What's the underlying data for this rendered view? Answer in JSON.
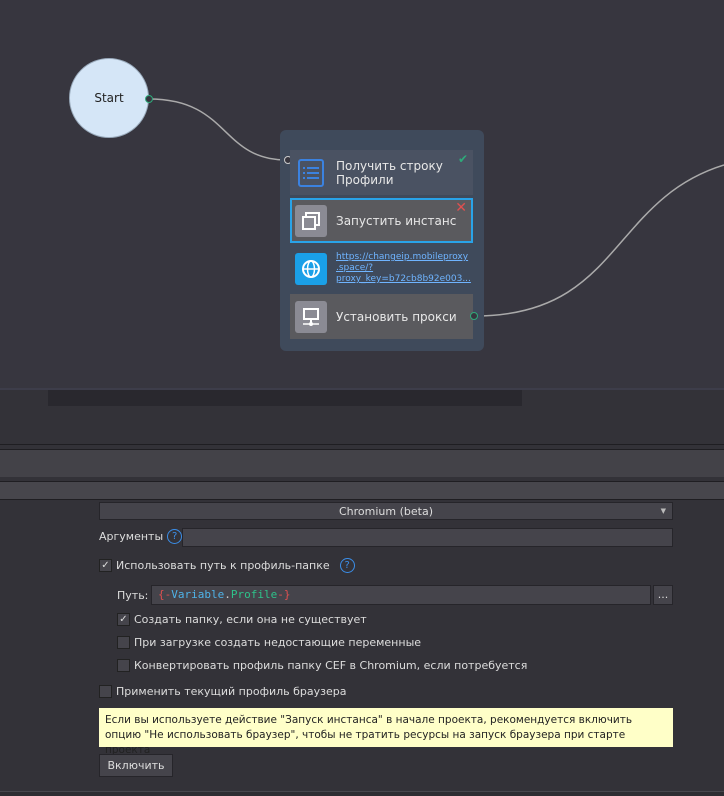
{
  "canvas": {
    "start_label": "Start",
    "nodes": [
      {
        "label": "Получить строку Профили",
        "status": "check",
        "icon": "list-icon"
      },
      {
        "label": "Запустить инстанс",
        "status": "error",
        "icon": "windows-icon"
      },
      {
        "link": "https://changeip.mobileproxy.space/?proxy_key=b72cb8b92e003...",
        "link_lines": [
          "https://changeip.mobileproxy",
          ".space/?",
          "proxy_key=b72cb8b92e003..."
        ],
        "icon": "globe-icon"
      },
      {
        "label": "Установить прокси",
        "icon": "network-icon"
      }
    ]
  },
  "settings": {
    "browser_select": "Chromium (beta)",
    "arguments_label": "Аргументы",
    "arguments_value": "",
    "use_profile_label": "Использовать путь к профиль-папке",
    "use_profile_checked": true,
    "path_label": "Путь:",
    "path_parts": [
      "{-",
      "Variable",
      ".",
      "Profile",
      "-}"
    ],
    "browse_label": "...",
    "create_folder_label": "Создать папку, если она не существует",
    "create_vars_label": "При загрузке создать недостающие переменные",
    "convert_label": "Конвертировать профиль папку CEF в Chromium, если потребуется",
    "apply_profile_label": "Применить текущий профиль браузера",
    "note": "Если вы используете действие \"Запуск инстанса\" в начале проекта, рекомендуется включить опцию \"Не использовать браузер\", чтобы не тратить ресурсы на запуск браузера при старте проекта",
    "enable_button": "Включить",
    "checkmark": "✓",
    "help": "?"
  },
  "colors": {
    "accent": "#29a3e8",
    "success": "#2eaa7a",
    "error": "#e05050",
    "note_bg": "#ffffc8"
  }
}
